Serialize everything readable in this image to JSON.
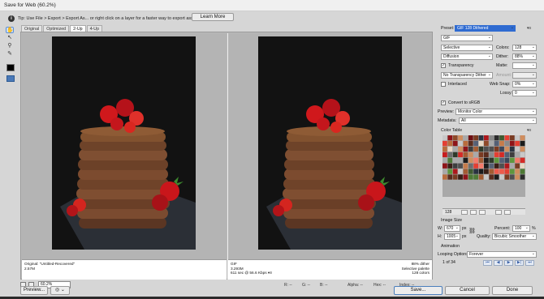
{
  "window": {
    "title": "Save for Web (60.2%)"
  },
  "tip": {
    "text": "Tip: Use File > Export > Export As...  or right click on a layer for a faster way to export assets",
    "button": "Learn More"
  },
  "tabs": [
    {
      "label": "Original"
    },
    {
      "label": "Optimized"
    },
    {
      "label": "2-Up"
    },
    {
      "label": "4-Up"
    }
  ],
  "left_pane": {
    "info_line1": "Original: \"Untitled-Recovered\"",
    "info_line2": "2.57M"
  },
  "right_pane": {
    "format": "GIF",
    "size": "3.293M",
    "time": "611 sec @ 56.6 Kbps",
    "dither": "88% dither",
    "palette": "Selective palette",
    "colors": "128 colors"
  },
  "status": {
    "zoom": "60.2%",
    "r": "R: --",
    "g": "G: --",
    "b": "B: --",
    "alpha": "Alpha: --",
    "hex": "Hex: --",
    "index": "Index: --"
  },
  "buttons": {
    "preview": "Preview...",
    "save": "Save...",
    "cancel": "Cancel",
    "done": "Done"
  },
  "settings": {
    "preset_label": "Preset:",
    "preset_value": "GIF 128 Dithered",
    "format": "GIF",
    "reduction": "Selective",
    "dither_algo": "Diffusion",
    "colors_label": "Colors:",
    "colors_value": "128",
    "dither_label": "Dither:",
    "dither_value": "88%",
    "transparency_label": "Transparency",
    "matte_label": "Matte:",
    "transparency_dither": "No Transparency Dither",
    "amount_label": "Amount:",
    "interlaced_label": "Interlaced",
    "websnap_label": "Web Snap:",
    "websnap_value": "0%",
    "lossy_label": "Lossy:",
    "lossy_value": "0",
    "convert_srgb_label": "Convert to sRGB",
    "preview_label": "Preview:",
    "preview_value": "Monitor Color",
    "metadata_label": "Metadata:",
    "metadata_value": "All",
    "color_table_label": "Color Table",
    "color_count": "128",
    "image_size_label": "Image Size",
    "w_label": "W:",
    "w_value": "670",
    "h_label": "H:",
    "h_value": "1005",
    "px_unit": "px",
    "percent_label": "Percent:",
    "percent_value": "100",
    "percent_unit": "%",
    "quality_label": "Quality:",
    "quality_value": "Bicubic Smoother",
    "animation_label": "Animation",
    "looping_label": "Looping Options:",
    "looping_value": "Forever",
    "frame_counter": "1 of 34"
  },
  "colors": {
    "accent": "#2f6bd1",
    "dialog_bg": "#d6d6d6",
    "photo_bg": "#121212"
  }
}
